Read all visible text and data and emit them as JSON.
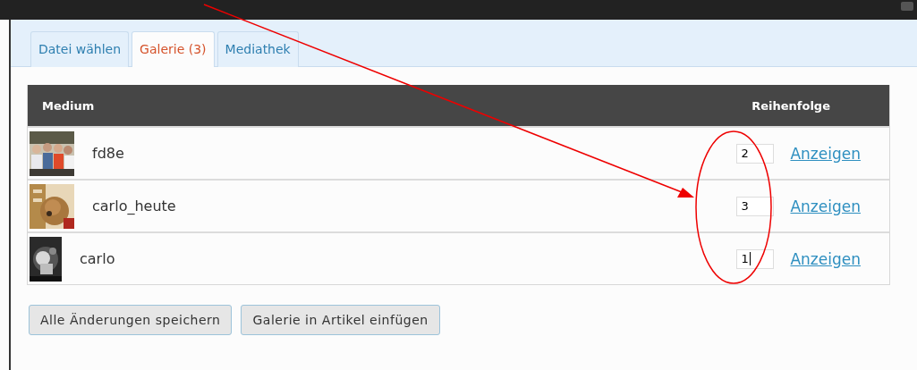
{
  "tabs": [
    {
      "label": "Datei wählen",
      "selected": false
    },
    {
      "label": "Galerie (3)",
      "selected": true
    },
    {
      "label": "Mediathek",
      "selected": false
    }
  ],
  "table": {
    "columns": [
      "Medium",
      "Reihenfolge"
    ],
    "rows": [
      {
        "name": "fd8e",
        "order": "2",
        "focused": false,
        "link": "Anzeigen"
      },
      {
        "name": "carlo_heute",
        "order": "3",
        "focused": false,
        "link": "Anzeigen"
      },
      {
        "name": "carlo",
        "order": "1",
        "focused": true,
        "link": "Anzeigen"
      }
    ]
  },
  "buttons": [
    "Alle Änderungen speichern",
    "Galerie in Artikel einfügen"
  ]
}
